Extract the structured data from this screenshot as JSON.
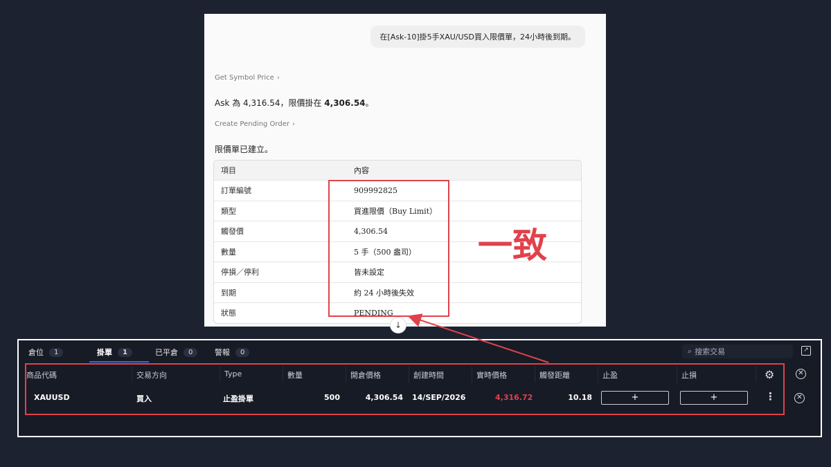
{
  "chat": {
    "user_message": "在[Ask-10]掛5手XAU/USD買入限價單，24小時後到期。",
    "tool1": "Get Symbol Price",
    "reply1_prefix": "Ask 為 4,316.54，限價掛在 ",
    "reply1_price": "4,306.54",
    "reply1_suffix": "。",
    "tool2": "Create Pending Order",
    "reply2": "限價單已建立。",
    "table": {
      "headers": [
        "項目",
        "內容"
      ],
      "rows": [
        [
          "訂單編號",
          "909992825"
        ],
        [
          "類型",
          "買進限價（Buy Limit）"
        ],
        [
          "觸發價",
          "4,306.54"
        ],
        [
          "數量",
          "5 手（500 盎司）"
        ],
        [
          "停損／停利",
          "皆未設定"
        ],
        [
          "到期",
          "約 24 小時後失效"
        ],
        [
          "狀態",
          "PENDING"
        ]
      ]
    },
    "scroll_glyph": "↓"
  },
  "annotation": {
    "label": "一致",
    "color": "#e0424b"
  },
  "panel": {
    "tabs": [
      {
        "label": "倉位",
        "count": "1"
      },
      {
        "label": "掛單",
        "count": "1"
      },
      {
        "label": "已平倉",
        "count": "0"
      },
      {
        "label": "警報",
        "count": "0"
      }
    ],
    "active_tab": "掛單",
    "search_placeholder": "搜索交易",
    "columns": [
      "商品代碼",
      "交易方向",
      "Type",
      "數量",
      "開倉價格",
      "創建時間",
      "實時價格",
      "觸發距離",
      "止盈",
      "止損"
    ],
    "row": {
      "symbol": "XAUUSD",
      "direction": "買入",
      "type": "止盈掛單",
      "quantity": "500",
      "open_price": "4,306.54",
      "created": "14/SEP/2026",
      "live_price": "4,316.72",
      "distance": "10.18",
      "tp": "+",
      "sl": "+"
    },
    "live_price_color": "#e0424b",
    "accent_color": "#3d63d8",
    "icons": [
      "search-icon",
      "popout-icon",
      "settings-icon",
      "kebab-icon",
      "close-icon"
    ]
  }
}
